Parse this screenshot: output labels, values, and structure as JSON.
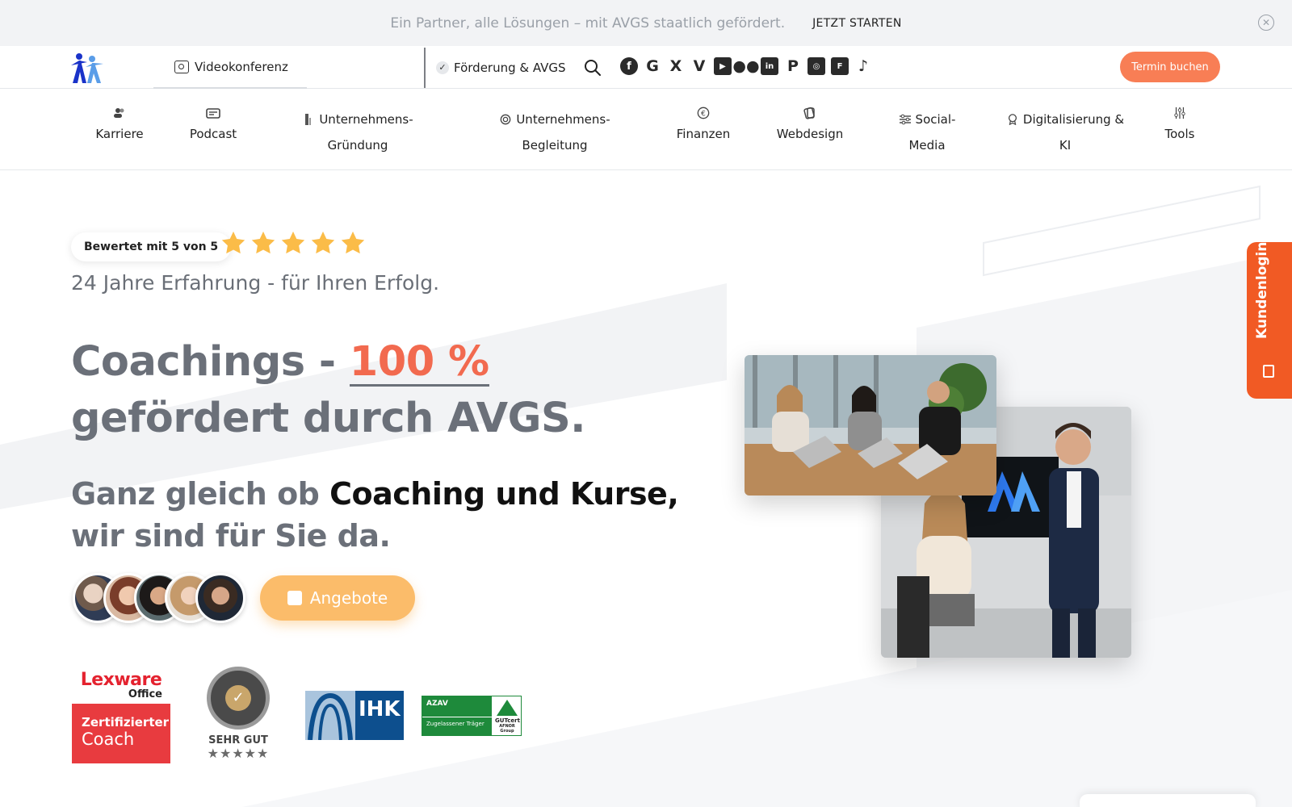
{
  "announcement": {
    "message": "Ein Partner, alle Lösungen – mit AVGS staatlich gefördert.",
    "cta": "JETZT STARTEN"
  },
  "topbar": {
    "videokonferenz": "Videokonferenz",
    "foerderung": "Förderung & AVGS",
    "termin_button": "Termin buchen",
    "social_icons": [
      "facebook-icon",
      "google-icon",
      "x-icon",
      "vimeo-icon",
      "youtube-icon",
      "flickr-icon",
      "linkedin-icon",
      "pinterest-icon",
      "instagram-icon",
      "flipboard-icon",
      "tiktok-icon"
    ]
  },
  "nav": {
    "karriere": "Karriere",
    "podcast": "Podcast",
    "gruendung_1": "Unternehmens-",
    "gruendung_2": "Gründung",
    "begleitung_1": "Unternehmens-",
    "begleitung_2": "Begleitung",
    "finanzen": "Finanzen",
    "webdesign": "Webdesign",
    "social_1": "Social-",
    "social_2": "Media",
    "digital_1": "Digitalisierung &",
    "digital_2": "KI",
    "tools": "Tools"
  },
  "hero": {
    "rating_text": "Bewertet mit 5 von 5",
    "stars": 5,
    "tagline": "24 Jahre Erfahrung - für Ihren Erfolg.",
    "headline_part1": "Coachings - ",
    "headline_accent": "100 %",
    "headline_part2": "gefördert durch AVGS.",
    "sub_part1": "Ganz gleich ob ",
    "sub_bold": "Coaching und Kurse,",
    "sub_part2": "wir sind für Sie da.",
    "cta_button": "Angebote"
  },
  "badges": {
    "lexware_brand": "Lexware",
    "lexware_sub": "Office",
    "lexware_cert_1": "Zertifizierter",
    "lexware_cert_2": "Coach",
    "provenexpert_rating": "SEHR GUT",
    "ihk": "IHK",
    "azav_title": "AZAV",
    "azav_sub": "Zugelassener Träger",
    "azav_cert": "GUTcert",
    "azav_group": "AFNOR Group"
  },
  "side_tab": {
    "label": "Kundenlogin"
  },
  "colors": {
    "accent_orange": "#f26a4f",
    "termin_button": "#f87e55",
    "angebote_button": "#fbbc6a",
    "side_tab": "#f15a24",
    "heading_gray": "#6b7079"
  }
}
